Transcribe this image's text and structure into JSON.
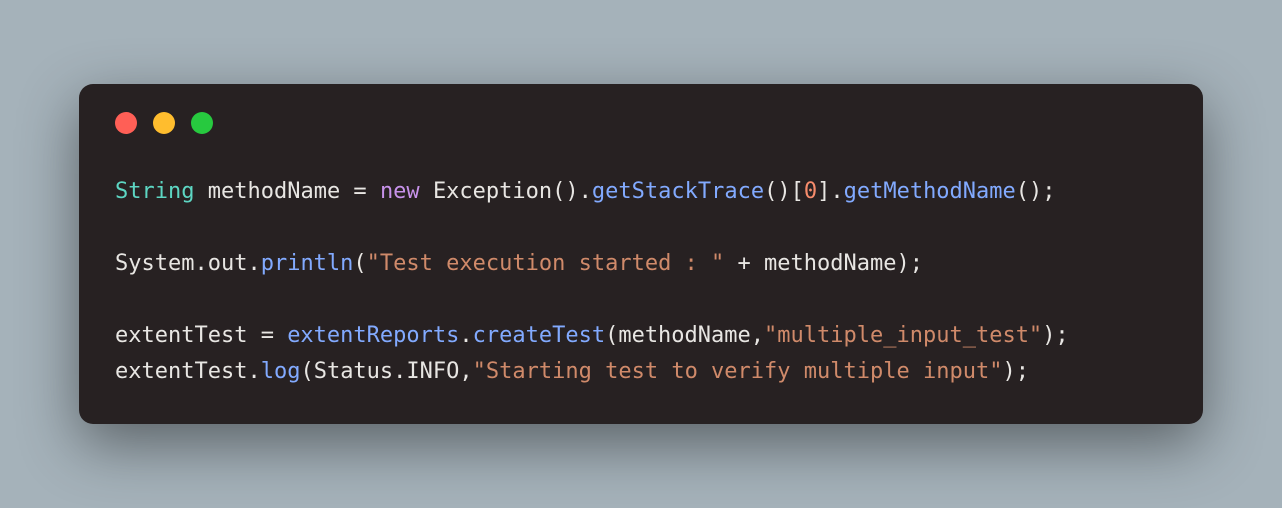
{
  "code": {
    "l1": {
      "type": "String",
      "space1": " ",
      "var": "methodName",
      "assign": " = ",
      "kw": "new",
      "space2": " ",
      "ctor": "Exception",
      "parens1": "().",
      "m1": "getStackTrace",
      "parens2": "()[",
      "idx": "0",
      "parens3": "].",
      "m2": "getMethodName",
      "parens4": "();"
    },
    "l3": {
      "sys": "System.out.",
      "m": "println",
      "open": "(",
      "str": "\"Test execution started : \"",
      "plus": " + methodName);"
    },
    "l5": {
      "lhs": "extentTest = ",
      "obj": "extentReports",
      "dot": ".",
      "m": "createTest",
      "open": "(methodName,",
      "str": "\"multiple_input_test\"",
      "close": ");"
    },
    "l6": {
      "lhs": "extentTest.",
      "m": "log",
      "open": "(Status.INFO,",
      "str": "\"Starting test to verify multiple input\"",
      "close": ");"
    }
  }
}
